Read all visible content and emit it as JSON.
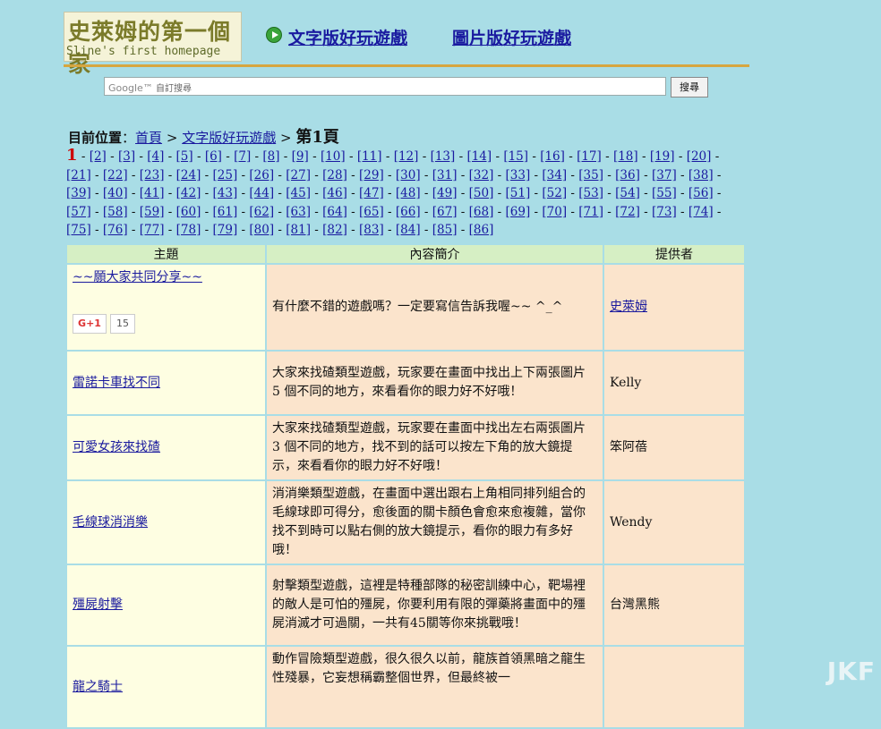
{
  "header": {
    "logo_cn": "史萊姆的第一個家",
    "logo_en": "Sline's first homepage",
    "nav_text_games": "文字版好玩遊戲",
    "nav_image_games": "圖片版好玩遊戲"
  },
  "search": {
    "google_mark": "Google™",
    "placeholder": "自訂搜尋",
    "button": "搜尋"
  },
  "breadcrumb": {
    "label": "目前位置",
    "sep": "：",
    "home": "首頁",
    "arrow": ">",
    "section": "文字版好玩遊戲",
    "current": "第1頁"
  },
  "pagination": {
    "current": "1",
    "last": 86
  },
  "table": {
    "headers": [
      "主題",
      "內容簡介",
      "提供者"
    ],
    "rows": [
      {
        "title": "~~願大家共同分享~~",
        "desc": "有什麼不錯的遊戲嗎？一定要寫信告訴我喔~~ ^_^",
        "author": "史萊姆",
        "author_link": true,
        "plusone": "G+1",
        "plus_count": "15"
      },
      {
        "title": "雷諾卡車找不同",
        "desc": "大家來找碴類型遊戲，玩家要在畫面中找出上下兩張圖片 5 個不同的地方，來看看你的眼力好不好哦！",
        "author": "Kelly"
      },
      {
        "title": "可愛女孩來找碴",
        "desc": "大家來找碴類型遊戲，玩家要在畫面中找出左右兩張圖片 3 個不同的地方，找不到的話可以按左下角的放大鏡提示，來看看你的眼力好不好哦！",
        "author": "笨阿蓓"
      },
      {
        "title": "毛線球消消樂",
        "desc": "消消樂類型遊戲，在畫面中選出跟右上角相同排列組合的毛線球即可得分，愈後面的關卡顏色會愈來愈複雜，當你找不到時可以點右側的放大鏡提示，看你的眼力有多好哦！",
        "author": "Wendy"
      },
      {
        "title": "殭屍射擊",
        "desc": "射擊類型遊戲，這裡是特種部隊的秘密訓練中心，靶場裡的敵人是可怕的殭屍，你要利用有限的彈藥將畫面中的殭屍消滅才可過關，一共有45關等你來挑戰哦！",
        "author": "台灣黑熊"
      },
      {
        "title": "龍之騎士",
        "desc": "動作冒險類型遊戲，很久很久以前，龍族首領黑暗之龍生性殘暴，它妄想稱霸整個世界，但最終被一",
        "author": ""
      }
    ]
  },
  "watermark": "JKF"
}
